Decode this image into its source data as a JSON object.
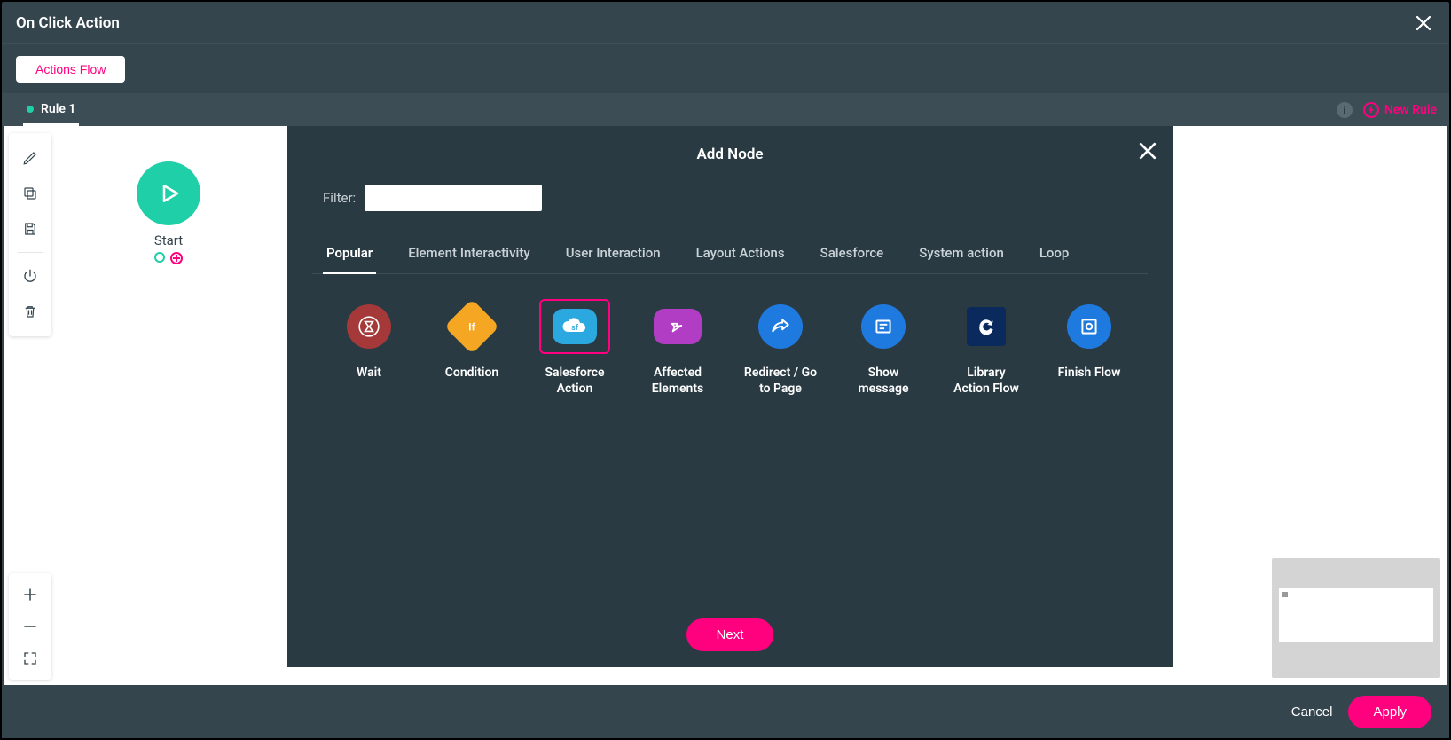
{
  "header": {
    "title": "On Click Action"
  },
  "subheader": {
    "actions_flow_label": "Actions Flow"
  },
  "rule_bar": {
    "active_rule_label": "Rule 1",
    "new_rule_label": "New Rule",
    "info_badge": "i"
  },
  "canvas": {
    "start_node_label": "Start"
  },
  "add_node_panel": {
    "title": "Add Node",
    "filter_label": "Filter:",
    "filter_value": "",
    "tabs": [
      {
        "label": "Popular",
        "active": true
      },
      {
        "label": "Element Interactivity",
        "active": false
      },
      {
        "label": "User Interaction",
        "active": false
      },
      {
        "label": "Layout Actions",
        "active": false
      },
      {
        "label": "Salesforce",
        "active": false
      },
      {
        "label": "System action",
        "active": false
      },
      {
        "label": "Loop",
        "active": false
      }
    ],
    "nodes": [
      {
        "label": "Wait",
        "icon": "hourglass",
        "bg": "#a53838",
        "selected": false
      },
      {
        "label": "Condition",
        "icon": "diamond",
        "bg": "#f5a623",
        "selected": false
      },
      {
        "label": "Salesforce\nAction",
        "icon": "cloud-sf",
        "bg": "#2ca8e0",
        "selected": true
      },
      {
        "label": "Affected\nElements",
        "icon": "sparkle",
        "bg": "#b13dc4",
        "selected": false
      },
      {
        "label": "Redirect / Go\nto Page",
        "icon": "share",
        "bg": "#1f7ae0",
        "selected": false
      },
      {
        "label": "Show\nmessage",
        "icon": "message",
        "bg": "#1f7ae0",
        "selected": false
      },
      {
        "label": "Library\nAction Flow",
        "icon": "refresh",
        "bg": "#0a2a5e",
        "selected": false
      },
      {
        "label": "Finish Flow",
        "icon": "finish",
        "bg": "#1f7ae0",
        "selected": false
      }
    ],
    "next_label": "Next"
  },
  "footer": {
    "cancel_label": "Cancel",
    "apply_label": "Apply"
  }
}
